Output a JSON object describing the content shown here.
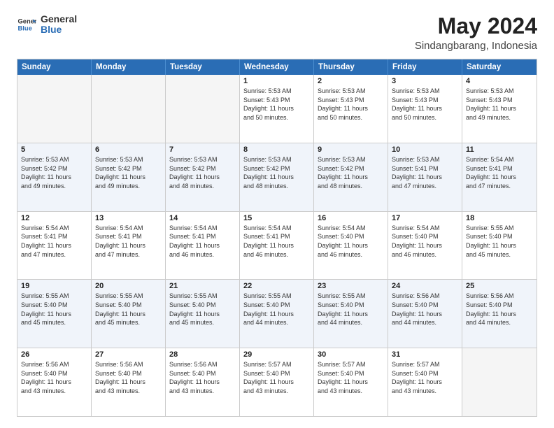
{
  "logo": {
    "line1": "General",
    "line2": "Blue"
  },
  "title": "May 2024",
  "subtitle": "Sindangbarang, Indonesia",
  "header_days": [
    "Sunday",
    "Monday",
    "Tuesday",
    "Wednesday",
    "Thursday",
    "Friday",
    "Saturday"
  ],
  "weeks": [
    {
      "alt": false,
      "days": [
        {
          "num": "",
          "info": ""
        },
        {
          "num": "",
          "info": ""
        },
        {
          "num": "",
          "info": ""
        },
        {
          "num": "1",
          "info": "Sunrise: 5:53 AM\nSunset: 5:43 PM\nDaylight: 11 hours\nand 50 minutes."
        },
        {
          "num": "2",
          "info": "Sunrise: 5:53 AM\nSunset: 5:43 PM\nDaylight: 11 hours\nand 50 minutes."
        },
        {
          "num": "3",
          "info": "Sunrise: 5:53 AM\nSunset: 5:43 PM\nDaylight: 11 hours\nand 50 minutes."
        },
        {
          "num": "4",
          "info": "Sunrise: 5:53 AM\nSunset: 5:43 PM\nDaylight: 11 hours\nand 49 minutes."
        }
      ]
    },
    {
      "alt": true,
      "days": [
        {
          "num": "5",
          "info": "Sunrise: 5:53 AM\nSunset: 5:42 PM\nDaylight: 11 hours\nand 49 minutes."
        },
        {
          "num": "6",
          "info": "Sunrise: 5:53 AM\nSunset: 5:42 PM\nDaylight: 11 hours\nand 49 minutes."
        },
        {
          "num": "7",
          "info": "Sunrise: 5:53 AM\nSunset: 5:42 PM\nDaylight: 11 hours\nand 48 minutes."
        },
        {
          "num": "8",
          "info": "Sunrise: 5:53 AM\nSunset: 5:42 PM\nDaylight: 11 hours\nand 48 minutes."
        },
        {
          "num": "9",
          "info": "Sunrise: 5:53 AM\nSunset: 5:42 PM\nDaylight: 11 hours\nand 48 minutes."
        },
        {
          "num": "10",
          "info": "Sunrise: 5:53 AM\nSunset: 5:41 PM\nDaylight: 11 hours\nand 47 minutes."
        },
        {
          "num": "11",
          "info": "Sunrise: 5:54 AM\nSunset: 5:41 PM\nDaylight: 11 hours\nand 47 minutes."
        }
      ]
    },
    {
      "alt": false,
      "days": [
        {
          "num": "12",
          "info": "Sunrise: 5:54 AM\nSunset: 5:41 PM\nDaylight: 11 hours\nand 47 minutes."
        },
        {
          "num": "13",
          "info": "Sunrise: 5:54 AM\nSunset: 5:41 PM\nDaylight: 11 hours\nand 47 minutes."
        },
        {
          "num": "14",
          "info": "Sunrise: 5:54 AM\nSunset: 5:41 PM\nDaylight: 11 hours\nand 46 minutes."
        },
        {
          "num": "15",
          "info": "Sunrise: 5:54 AM\nSunset: 5:41 PM\nDaylight: 11 hours\nand 46 minutes."
        },
        {
          "num": "16",
          "info": "Sunrise: 5:54 AM\nSunset: 5:40 PM\nDaylight: 11 hours\nand 46 minutes."
        },
        {
          "num": "17",
          "info": "Sunrise: 5:54 AM\nSunset: 5:40 PM\nDaylight: 11 hours\nand 46 minutes."
        },
        {
          "num": "18",
          "info": "Sunrise: 5:55 AM\nSunset: 5:40 PM\nDaylight: 11 hours\nand 45 minutes."
        }
      ]
    },
    {
      "alt": true,
      "days": [
        {
          "num": "19",
          "info": "Sunrise: 5:55 AM\nSunset: 5:40 PM\nDaylight: 11 hours\nand 45 minutes."
        },
        {
          "num": "20",
          "info": "Sunrise: 5:55 AM\nSunset: 5:40 PM\nDaylight: 11 hours\nand 45 minutes."
        },
        {
          "num": "21",
          "info": "Sunrise: 5:55 AM\nSunset: 5:40 PM\nDaylight: 11 hours\nand 45 minutes."
        },
        {
          "num": "22",
          "info": "Sunrise: 5:55 AM\nSunset: 5:40 PM\nDaylight: 11 hours\nand 44 minutes."
        },
        {
          "num": "23",
          "info": "Sunrise: 5:55 AM\nSunset: 5:40 PM\nDaylight: 11 hours\nand 44 minutes."
        },
        {
          "num": "24",
          "info": "Sunrise: 5:56 AM\nSunset: 5:40 PM\nDaylight: 11 hours\nand 44 minutes."
        },
        {
          "num": "25",
          "info": "Sunrise: 5:56 AM\nSunset: 5:40 PM\nDaylight: 11 hours\nand 44 minutes."
        }
      ]
    },
    {
      "alt": false,
      "days": [
        {
          "num": "26",
          "info": "Sunrise: 5:56 AM\nSunset: 5:40 PM\nDaylight: 11 hours\nand 43 minutes."
        },
        {
          "num": "27",
          "info": "Sunrise: 5:56 AM\nSunset: 5:40 PM\nDaylight: 11 hours\nand 43 minutes."
        },
        {
          "num": "28",
          "info": "Sunrise: 5:56 AM\nSunset: 5:40 PM\nDaylight: 11 hours\nand 43 minutes."
        },
        {
          "num": "29",
          "info": "Sunrise: 5:57 AM\nSunset: 5:40 PM\nDaylight: 11 hours\nand 43 minutes."
        },
        {
          "num": "30",
          "info": "Sunrise: 5:57 AM\nSunset: 5:40 PM\nDaylight: 11 hours\nand 43 minutes."
        },
        {
          "num": "31",
          "info": "Sunrise: 5:57 AM\nSunset: 5:40 PM\nDaylight: 11 hours\nand 43 minutes."
        },
        {
          "num": "",
          "info": ""
        }
      ]
    }
  ]
}
